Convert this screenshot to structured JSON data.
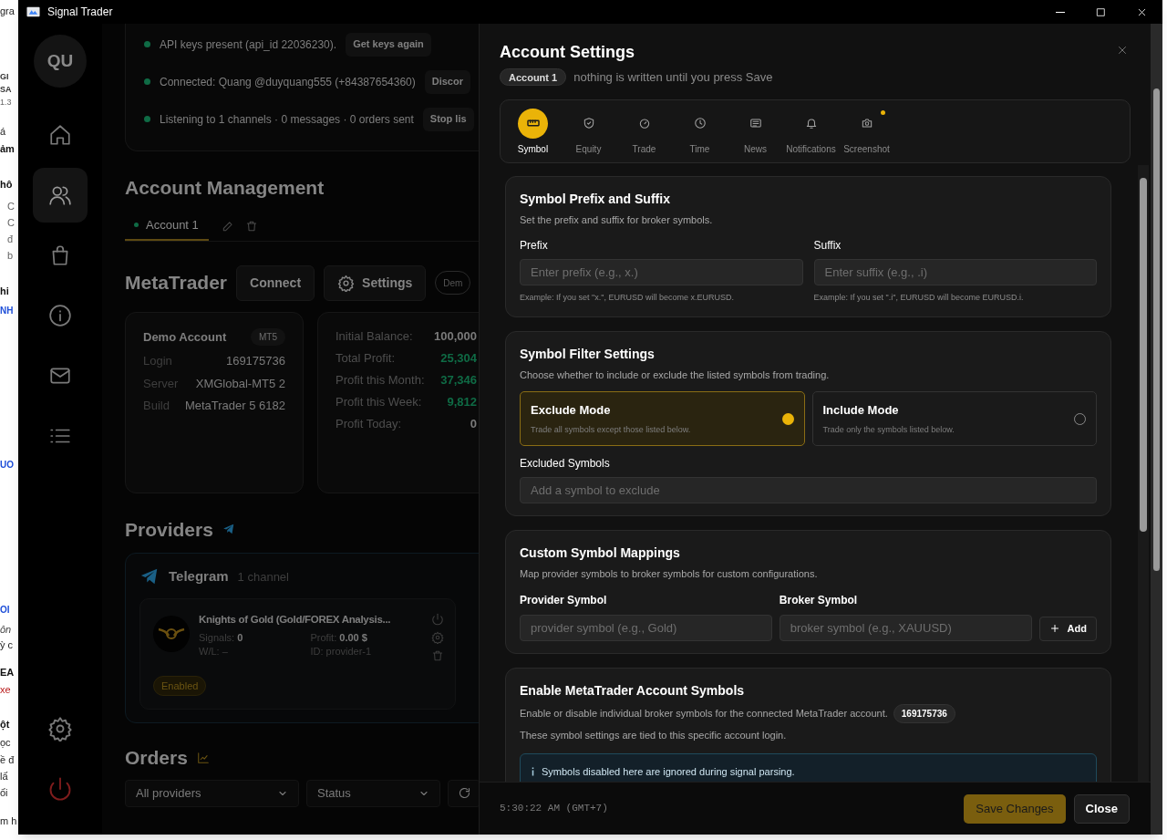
{
  "background_page": {
    "fragments": [
      {
        "text": "gra",
        "kind": "text"
      },
      {
        "text": "GI",
        "kind": "small"
      },
      {
        "text": "SA",
        "kind": "small"
      },
      {
        "text": "1.3",
        "kind": "tiny"
      },
      {
        "text": "á",
        "kind": "text"
      },
      {
        "text": "ảm",
        "kind": "bold"
      },
      {
        "text": "hô",
        "kind": "bold"
      },
      {
        "text": "C",
        "kind": "muted"
      },
      {
        "text": "C",
        "kind": "muted"
      },
      {
        "text": "đ",
        "kind": "muted"
      },
      {
        "text": "b",
        "kind": "muted"
      },
      {
        "text": "hi",
        "kind": "bold"
      },
      {
        "text": "NH",
        "kind": "link"
      },
      {
        "text": "UO",
        "kind": "link"
      },
      {
        "text": "OI",
        "kind": "link"
      },
      {
        "text": "ôn",
        "kind": "italic"
      },
      {
        "text": "ỳ c",
        "kind": "text"
      },
      {
        "text": "EA",
        "kind": "bold"
      },
      {
        "text": "xe",
        "kind": "red"
      },
      {
        "text": "ột",
        "kind": "bold"
      },
      {
        "text": "ọc",
        "kind": "text"
      },
      {
        "text": "ề đ",
        "kind": "text"
      },
      {
        "text": "lấ",
        "kind": "text"
      },
      {
        "text": "ối",
        "kind": "text"
      },
      {
        "text": "m h",
        "kind": "text"
      }
    ]
  },
  "window": {
    "title": "Signal Trader"
  },
  "sidebar": {
    "avatar": "QU",
    "items": [
      {
        "kind": "home",
        "selected": false
      },
      {
        "kind": "users",
        "selected": true
      },
      {
        "kind": "bag",
        "selected": false
      },
      {
        "kind": "info",
        "selected": false
      },
      {
        "kind": "mail",
        "selected": false
      },
      {
        "kind": "list",
        "selected": false
      }
    ],
    "bottom": [
      {
        "kind": "settings"
      },
      {
        "kind": "power"
      }
    ]
  },
  "telegram_status": [
    {
      "text": "API keys present (api_id 22036230).",
      "button": "Get keys again"
    },
    {
      "text": "Connected: Quang @duyquang555 (+84387654360)",
      "button": "Discor"
    },
    {
      "text": "Listening to 1 channels · 0 messages · 0 orders sent",
      "button": "Stop lis"
    }
  ],
  "account_management": {
    "title": "Account Management",
    "tabs": [
      {
        "label": "Account 1",
        "selected": true
      }
    ]
  },
  "metatrader": {
    "title": "MetaTrader",
    "buttons": [
      {
        "label": "Connect",
        "kind": "plain"
      },
      {
        "label": "Settings",
        "kind": "settings"
      }
    ],
    "badge": "Dem",
    "account": {
      "title": "Demo Account",
      "platform": "MT5",
      "rows": [
        {
          "label": "Login",
          "value": "169175736"
        },
        {
          "label": "Server",
          "value": "XMGlobal-MT5 2"
        },
        {
          "label": "Build",
          "value": "MetaTrader 5 6182"
        }
      ]
    },
    "stats": [
      {
        "label": "Initial Balance:",
        "value": "100,000",
        "kind": "neutral"
      },
      {
        "label": "Total Profit:",
        "value": "25,304",
        "kind": "positive"
      },
      {
        "label": "Profit this Month:",
        "value": "37,346",
        "kind": "positive"
      },
      {
        "label": "Profit this Week:",
        "value": "9,812",
        "kind": "positive"
      },
      {
        "label": "Profit Today:",
        "value": "0",
        "kind": "neutral"
      }
    ]
  },
  "providers": {
    "title": "Providers",
    "group": {
      "name": "Telegram",
      "count": "1 channel",
      "channels": [
        {
          "name": "Knights of Gold (Gold/FOREX Analysis...",
          "signals_label": "Signals:",
          "signals": "0",
          "wl": "W/L: –",
          "profit_label": "Profit:",
          "profit": "0.00 $",
          "id": "ID: provider-1",
          "status": "Enabled",
          "enabled": true
        }
      ]
    }
  },
  "orders": {
    "title": "Orders",
    "filters": [
      "All providers",
      "Status"
    ]
  },
  "modal": {
    "title": "Account Settings",
    "account_badge": "Account 1",
    "subtitle": "nothing is written until you press Save",
    "tabs": [
      {
        "label": "Symbol",
        "kind": "ruler",
        "selected": true,
        "indicator": false
      },
      {
        "label": "Equity",
        "kind": "shield",
        "selected": false,
        "indicator": false
      },
      {
        "label": "Trade",
        "kind": "gauge",
        "selected": false,
        "indicator": false
      },
      {
        "label": "Time",
        "kind": "clock",
        "selected": false,
        "indicator": false
      },
      {
        "label": "News",
        "kind": "news",
        "selected": false,
        "indicator": false
      },
      {
        "label": "Notifications",
        "kind": "bell",
        "selected": false,
        "indicator": false
      },
      {
        "label": "Screenshot",
        "kind": "camera",
        "selected": false,
        "indicator": true
      }
    ],
    "prefix_suffix": {
      "title": "Symbol Prefix and Suffix",
      "description": "Set the prefix and suffix for broker symbols.",
      "fields": [
        {
          "label": "Prefix",
          "placeholder": "Enter prefix (e.g., x.)",
          "hint": "Example: If you set \"x.\", EURUSD will become x.EURUSD."
        },
        {
          "label": "Suffix",
          "placeholder": "Enter suffix (e.g., .i)",
          "hint": "Example: If you set \".i\", EURUSD will become EURUSD.i."
        }
      ]
    },
    "symbol_filter": {
      "title": "Symbol Filter Settings",
      "description": "Choose whether to include or exclude the listed symbols from trading.",
      "modes": [
        {
          "title": "Exclude Mode",
          "description": "Trade all symbols except those listed below.",
          "selected": true
        },
        {
          "title": "Include Mode",
          "description": "Trade only the symbols listed below.",
          "selected": false
        }
      ],
      "list_label": "Excluded Symbols",
      "placeholder": "Add a symbol to exclude"
    },
    "mappings": {
      "title": "Custom Symbol Mappings",
      "description": "Map provider symbols to broker symbols for custom configurations.",
      "fields": [
        {
          "label": "Provider Symbol",
          "placeholder": "provider symbol (e.g., Gold)"
        },
        {
          "label": "Broker Symbol",
          "placeholder": "broker symbol (e.g., XAUUSD)"
        }
      ],
      "add_button": "Add"
    },
    "account_symbols": {
      "title": "Enable MetaTrader Account Symbols",
      "description": "Enable or disable individual broker symbols for the connected MetaTrader account.",
      "login": "169175736",
      "note": "These symbol settings are tied to this specific account login.",
      "info": "Symbols disabled here are ignored during signal parsing."
    },
    "footer": {
      "time": "5:30:22 AM (GMT+7)",
      "buttons": [
        {
          "label": "Save Changes",
          "kind": "primary"
        },
        {
          "label": "Close",
          "kind": "secondary"
        }
      ]
    }
  }
}
